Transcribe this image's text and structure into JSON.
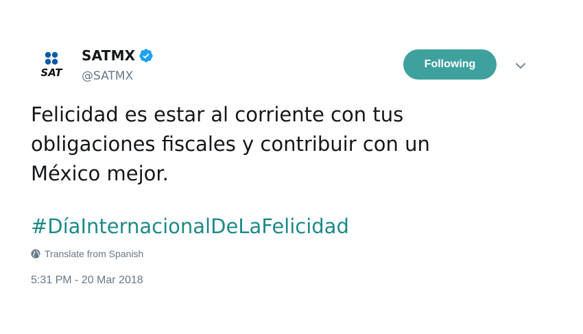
{
  "author": {
    "avatar_text": "SAT",
    "display_name": "SATMX",
    "handle": "@SATMX",
    "verified": true
  },
  "actions": {
    "follow_label": "Following",
    "more_icon": "chevron-down-icon"
  },
  "tweet": {
    "text_lines": [
      "Felicidad es estar al corriente con tus",
      "obligaciones fiscales y contribuir con un",
      "México mejor."
    ],
    "hashtag": "#DíaInternacionalDeLaFelicidad",
    "translate_label": "Translate from Spanish",
    "timestamp": "5:31 PM - 20 Mar 2018"
  },
  "colors": {
    "follow_button": "#3ea19e",
    "hashtag": "#1b8a88",
    "verified": "#1da1f2",
    "secondary_text": "#657786",
    "logo_blue": "#0a5aa8"
  }
}
